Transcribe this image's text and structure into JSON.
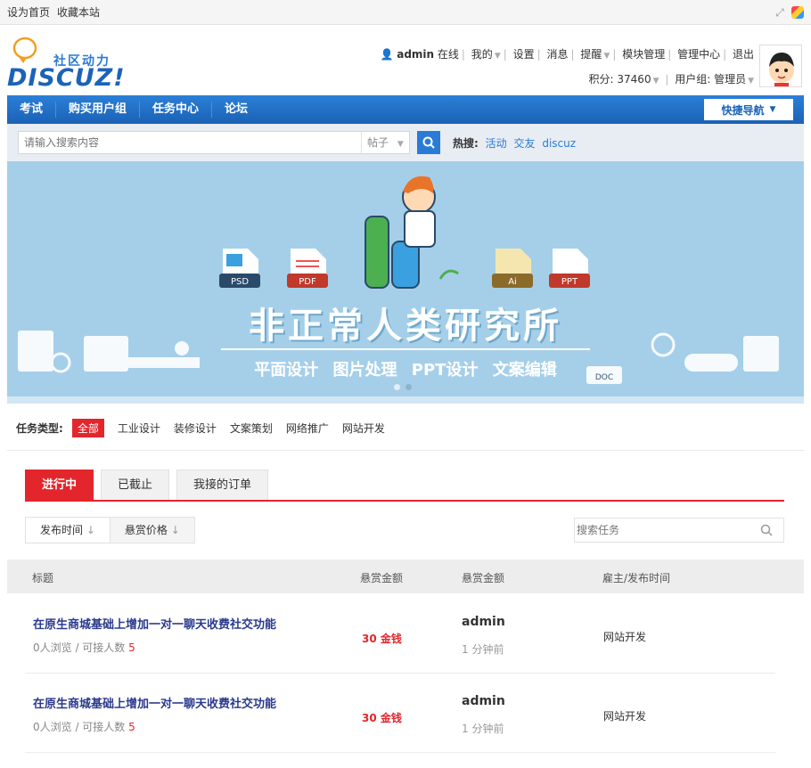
{
  "topbar": {
    "set_home": "设为首页",
    "bookmark": "收藏本站"
  },
  "logo": {
    "cn": "社区动力",
    "en": "DISCUZ!"
  },
  "user": {
    "name": "admin",
    "status": "在线",
    "my": "我的",
    "settings": "设置",
    "messages": "消息",
    "remind": "提醒",
    "modules": "模块管理",
    "admin_center": "管理中心",
    "logout": "退出",
    "points": "积分: 37460",
    "group": "用户组: 管理员"
  },
  "nav": {
    "items": [
      "考试",
      "购买用户组",
      "任务中心",
      "论坛"
    ],
    "quick": "快捷导航"
  },
  "search": {
    "placeholder": "请输入搜索内容",
    "type": "帖子",
    "hot_label": "热搜:",
    "hot": [
      "活动",
      "交友",
      "discuz"
    ]
  },
  "banner": {
    "title": "非正常人类研究所",
    "subtitle": "平面设计  图片处理  PPT设计  文案编辑",
    "badges": [
      "PSD",
      "PDF",
      "Ai",
      "PPT",
      "DOC"
    ]
  },
  "filter": {
    "label": "任务类型:",
    "options": [
      "全部",
      "工业设计",
      "装修设计",
      "文案策划",
      "网络推广",
      "网站开发"
    ]
  },
  "tabs": [
    "进行中",
    "已截止",
    "我接的订单"
  ],
  "sorts": [
    "发布时间",
    "悬赏价格"
  ],
  "task_search_placeholder": "搜索任务",
  "table": {
    "headers": [
      "标题",
      "悬赏金额",
      "悬赏金额",
      "雇主/发布时间"
    ],
    "rows": [
      {
        "title": "在原生商城基础上增加一对一聊天收费社交功能",
        "views": "0人浏览 / 可接人数",
        "slots": "5",
        "reward": "30 金钱",
        "user": "admin",
        "time": "1 分钟前",
        "category": "网站开发"
      },
      {
        "title": "在原生商城基础上增加一对一聊天收费社交功能",
        "views": "0人浏览 / 可接人数",
        "slots": "5",
        "reward": "30 金钱",
        "user": "admin",
        "time": "1 分钟前",
        "category": "网站开发"
      }
    ]
  },
  "colors": {
    "brand": "#1a62b7",
    "accent": "#e3262c",
    "banner": "#a5cfe9"
  }
}
